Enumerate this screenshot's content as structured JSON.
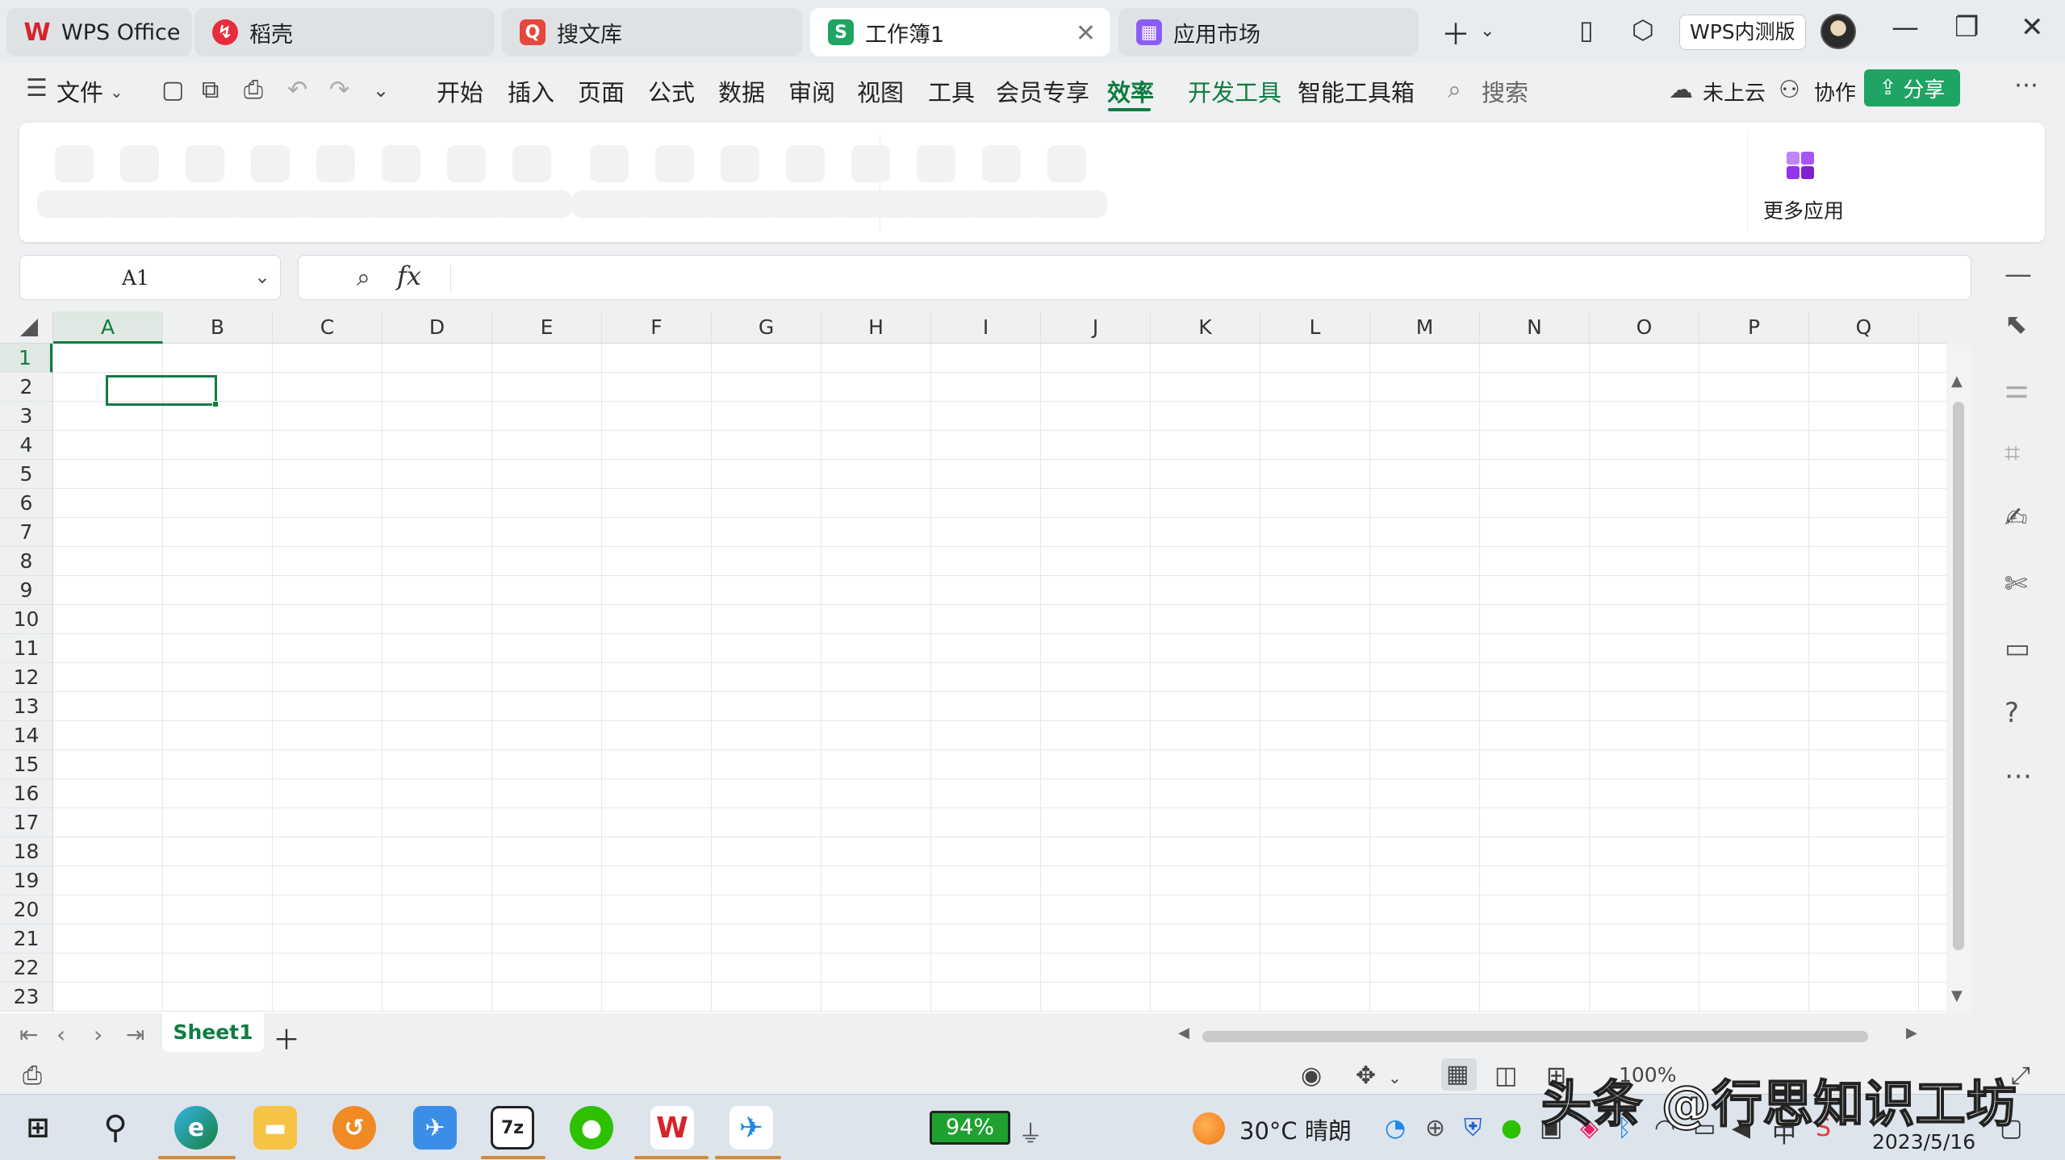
{
  "tabs": [
    {
      "label": "WPS Office",
      "icon": "wps-logo-icon",
      "color": "#d6232a"
    },
    {
      "label": "稻壳",
      "icon": "daoke-icon",
      "color": "#e52d3c"
    },
    {
      "label": "搜文库",
      "icon": "souwenku-icon",
      "color": "#e5483c"
    },
    {
      "label": "工作簿1",
      "icon": "spreadsheet-icon",
      "color": "#1fa463"
    },
    {
      "label": "应用市场",
      "icon": "app-market-icon",
      "color": "#8b5cf6"
    }
  ],
  "titlebar": {
    "edition_badge": "WPS内测版"
  },
  "menu": {
    "file_label": "文件",
    "items": [
      "开始",
      "插入",
      "页面",
      "公式",
      "数据",
      "审阅",
      "视图",
      "工具",
      "会员专享",
      "效率",
      "开发工具",
      "智能工具箱"
    ],
    "active": "效率",
    "search_label": "搜索",
    "cloud_label": "未上云",
    "collab_label": "协作",
    "share_label": "分享"
  },
  "ribbon": {
    "more_apps_label": "更多应用"
  },
  "formula_bar": {
    "cell_ref": "A1",
    "fx_label": "fx",
    "formula": ""
  },
  "grid": {
    "columns": [
      "A",
      "B",
      "C",
      "D",
      "E",
      "F",
      "G",
      "H",
      "I",
      "J",
      "K",
      "L",
      "M",
      "N",
      "O",
      "P",
      "Q"
    ],
    "rows": [
      "1",
      "2",
      "3",
      "4",
      "5",
      "6",
      "7",
      "8",
      "9",
      "10",
      "11",
      "12",
      "13",
      "14",
      "15",
      "16",
      "17",
      "18",
      "19",
      "20",
      "21",
      "22",
      "23"
    ],
    "selected_cell": "A1"
  },
  "sheets": {
    "tabs": [
      "Sheet1"
    ],
    "active": "Sheet1"
  },
  "statusbar": {
    "zoom": "100%"
  },
  "taskbar": {
    "battery": "94%",
    "weather": "30°C 晴朗",
    "date": "2023/5/16"
  },
  "watermark": "头条 @行思知识工坊",
  "colors": {
    "accent": "#107c41",
    "share": "#1fa463"
  }
}
